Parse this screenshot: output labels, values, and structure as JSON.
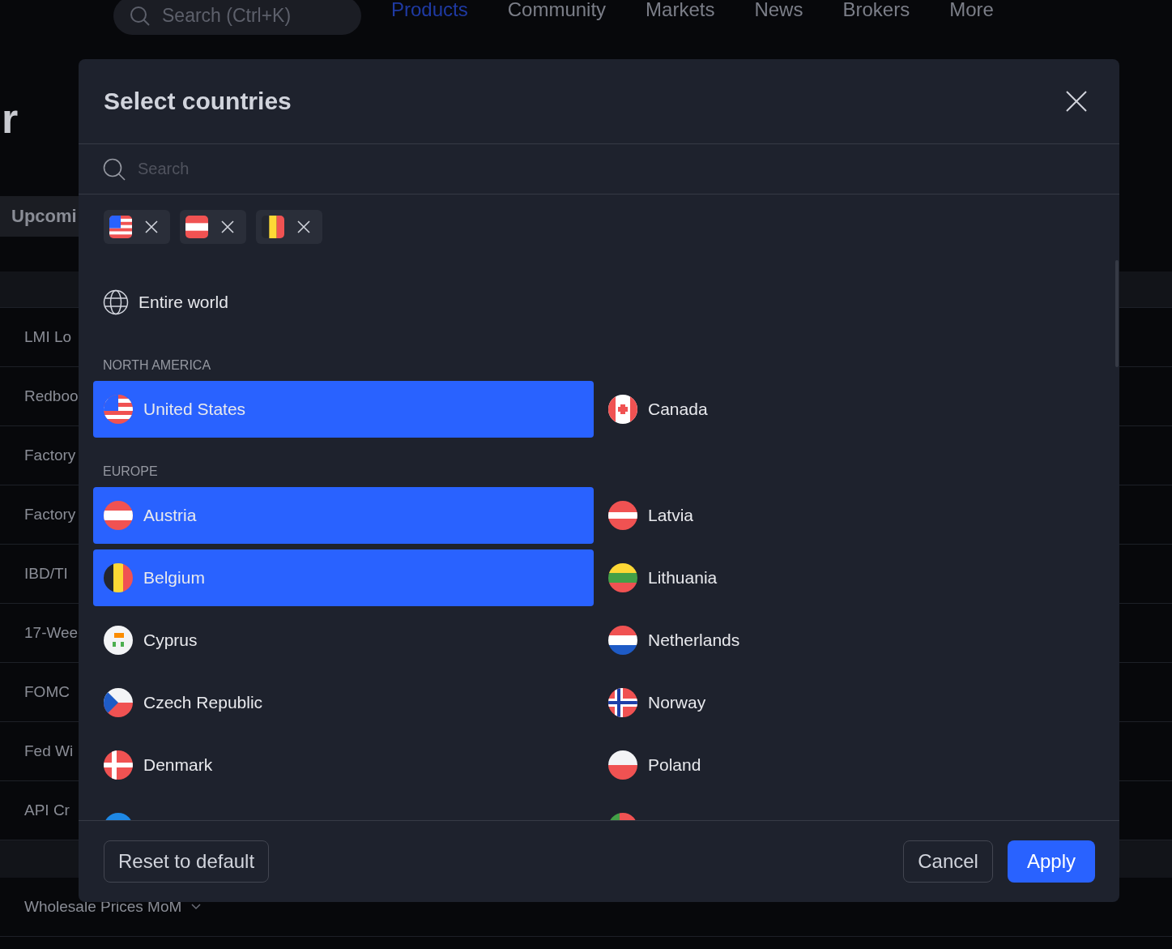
{
  "nav": {
    "search": {
      "placeholder": "Search (Ctrl+K)"
    },
    "links": [
      {
        "label": "Products",
        "selected": true
      },
      {
        "label": "Community",
        "selected": false
      },
      {
        "label": "Markets",
        "selected": false
      },
      {
        "label": "News",
        "selected": false
      },
      {
        "label": "Brokers",
        "selected": false
      },
      {
        "label": "More",
        "selected": false
      }
    ]
  },
  "page": {
    "title": "r",
    "tab": "Upcomi",
    "rows": [
      "LMI Lo",
      "Redboo",
      "Factory",
      "Factory",
      "IBD/TI",
      "17-Wee",
      "FOMC",
      "Fed Wi",
      "API Cr"
    ],
    "last_row": "Wholesale Prices MoM"
  },
  "dialog": {
    "title": "Select countries",
    "search": {
      "placeholder": "Search"
    },
    "chips": [
      {
        "kind": "us"
      },
      {
        "kind": "austria"
      },
      {
        "kind": "belgium"
      }
    ],
    "entire_world": "Entire world",
    "regions": [
      {
        "name": "NORTH AMERICA",
        "countries": [
          {
            "name": "United States",
            "kind": "us",
            "selected": true
          },
          {
            "name": "Canada",
            "kind": "canada",
            "selected": false
          }
        ]
      },
      {
        "name": "EUROPE",
        "countries": [
          {
            "name": "Austria",
            "kind": "austria",
            "selected": true
          },
          {
            "name": "Latvia",
            "kind": "latvia",
            "selected": false
          },
          {
            "name": "Belgium",
            "kind": "belgium",
            "selected": true
          },
          {
            "name": "Lithuania",
            "kind": "lithuania",
            "selected": false
          },
          {
            "name": "Cyprus",
            "kind": "cyprus",
            "selected": false
          },
          {
            "name": "Netherlands",
            "kind": "netherlands",
            "selected": false
          },
          {
            "name": "Czech Republic",
            "kind": "czech",
            "selected": false
          },
          {
            "name": "Norway",
            "kind": "norway",
            "selected": false
          },
          {
            "name": "Denmark",
            "kind": "denmark",
            "selected": false
          },
          {
            "name": "Poland",
            "kind": "poland",
            "selected": false
          },
          {
            "kind": "estonia",
            "selected": false
          },
          {
            "kind": "portugal",
            "selected": false
          }
        ]
      }
    ],
    "buttons": [
      {
        "label": "Reset to default",
        "kind": "outline"
      },
      {
        "label": "Cancel",
        "kind": "outline"
      },
      {
        "label": "Apply",
        "kind": "primary"
      }
    ]
  }
}
